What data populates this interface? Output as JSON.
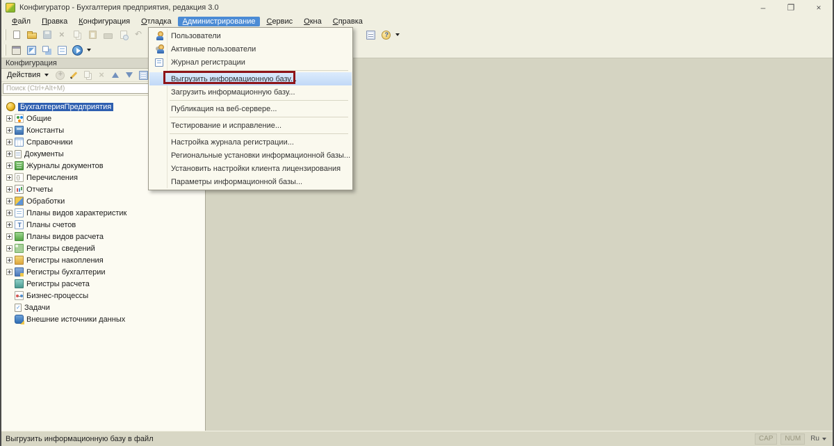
{
  "window": {
    "title": "Конфигуратор - Бухгалтерия предприятия, редакция 3.0",
    "controls": [
      {
        "name": "minimize-button",
        "glyph": "–"
      },
      {
        "name": "maximize-button",
        "glyph": "❐"
      },
      {
        "name": "close-button",
        "glyph": "×"
      }
    ]
  },
  "menubar": {
    "items": [
      {
        "label": "Файл"
      },
      {
        "label": "Правка"
      },
      {
        "label": "Конфигурация"
      },
      {
        "label": "Отладка"
      },
      {
        "label": "Администрирование",
        "selected": true
      },
      {
        "label": "Сервис"
      },
      {
        "label": "Окна"
      },
      {
        "label": "Справка"
      }
    ]
  },
  "toolbar_standard": {
    "left_icons": [
      {
        "name": "new-document-icon"
      },
      {
        "name": "open-icon"
      },
      {
        "name": "save-icon",
        "disabled": true
      },
      {
        "name": "cut-icon",
        "disabled": true
      },
      {
        "name": "copy-icon",
        "disabled": true
      },
      {
        "name": "paste-icon",
        "disabled": true
      },
      {
        "name": "print-icon",
        "disabled": true
      },
      {
        "name": "print-preview-icon",
        "disabled": true
      },
      {
        "name": "undo-icon",
        "disabled": true
      },
      {
        "name": "redo-icon",
        "disabled": true
      }
    ],
    "right_icons": [
      {
        "name": "calculator-icon"
      },
      {
        "name": "help-icon",
        "caret": true
      }
    ]
  },
  "toolbar_configurator": {
    "icons": [
      {
        "name": "configuration-window-icon"
      },
      {
        "name": "update-database-configuration-icon"
      },
      {
        "name": "compare-configurations-icon"
      },
      {
        "name": "database-configuration-icon"
      },
      {
        "name": "start-debugging-icon",
        "caret": true
      }
    ]
  },
  "config_panel": {
    "title": "Конфигурация",
    "actions_button": {
      "label": "Действия"
    },
    "action_icons": [
      {
        "name": "add-icon",
        "disabled": true
      },
      {
        "name": "edit-icon"
      },
      {
        "name": "copy-item-icon",
        "disabled": true
      },
      {
        "name": "delete-icon",
        "disabled": true
      },
      {
        "name": "move-up-icon"
      },
      {
        "name": "move-down-icon"
      },
      {
        "name": "sort-icon"
      },
      {
        "name": "filter-icon"
      }
    ],
    "search": {
      "placeholder": "Поиск (Ctrl+Alt+M)"
    },
    "tree": {
      "root": {
        "label": "БухгалтерияПредприятия",
        "icon": "configuration-root-icon",
        "selected": true
      },
      "items": [
        {
          "label": "Общие",
          "icon": "common-icon",
          "expandable": true
        },
        {
          "label": "Константы",
          "icon": "constants-icon",
          "expandable": true
        },
        {
          "label": "Справочники",
          "icon": "catalogs-icon",
          "expandable": true
        },
        {
          "label": "Документы",
          "icon": "documents-icon",
          "expandable": true
        },
        {
          "label": "Журналы документов",
          "icon": "document-journals-icon",
          "expandable": true
        },
        {
          "label": "Перечисления",
          "icon": "enumerations-icon",
          "expandable": true
        },
        {
          "label": "Отчеты",
          "icon": "reports-icon",
          "expandable": true
        },
        {
          "label": "Обработки",
          "icon": "data-processors-icon",
          "expandable": true
        },
        {
          "label": "Планы видов характеристик",
          "icon": "chart-of-characteristic-types-icon",
          "expandable": true
        },
        {
          "label": "Планы счетов",
          "icon": "chart-of-accounts-icon",
          "expandable": true
        },
        {
          "label": "Планы видов расчета",
          "icon": "chart-of-calculation-types-icon",
          "expandable": true
        },
        {
          "label": "Регистры сведений",
          "icon": "information-registers-icon",
          "expandable": true
        },
        {
          "label": "Регистры накопления",
          "icon": "accumulation-registers-icon",
          "expandable": true
        },
        {
          "label": "Регистры бухгалтерии",
          "icon": "accounting-registers-icon",
          "expandable": true
        },
        {
          "label": "Регистры расчета",
          "icon": "calculation-registers-icon",
          "expandable": false
        },
        {
          "label": "Бизнес-процессы",
          "icon": "business-processes-icon",
          "expandable": false
        },
        {
          "label": "Задачи",
          "icon": "tasks-icon",
          "expandable": false
        },
        {
          "label": "Внешние источники данных",
          "icon": "external-data-sources-icon",
          "expandable": false
        }
      ]
    }
  },
  "admin_menu": {
    "items": [
      {
        "label": "Пользователи",
        "icon": "user-icon"
      },
      {
        "label": "Активные пользователи",
        "icon": "active-users-icon"
      },
      {
        "label": "Журнал регистрации",
        "icon": "registration-journal-icon",
        "separator_after": true
      },
      {
        "label": "Выгрузить информационную базу...",
        "highlighted": true,
        "annotated": true
      },
      {
        "label": "Загрузить информационную базу...",
        "separator_after": true
      },
      {
        "label": "Публикация на веб-сервере...",
        "separator_after": true
      },
      {
        "label": "Тестирование и исправление...",
        "separator_after": true
      },
      {
        "label": "Настройка журнала регистрации..."
      },
      {
        "label": "Региональные установки информационной базы..."
      },
      {
        "label": "Установить настройки клиента лицензирования"
      },
      {
        "label": "Параметры информационной базы..."
      }
    ]
  },
  "statusbar": {
    "message": "Выгрузить информационную базу в файл",
    "indicators": [
      {
        "label": "CAP"
      },
      {
        "label": "NUM"
      }
    ],
    "language": {
      "label": "Ru"
    }
  },
  "colors": {
    "chrome": "#f0efe1",
    "workspace": "#d5d4c2",
    "selection_blue": "#2e5fb0",
    "menu_highlight": "#c1d9f7",
    "annotation_red": "#8e1418"
  }
}
